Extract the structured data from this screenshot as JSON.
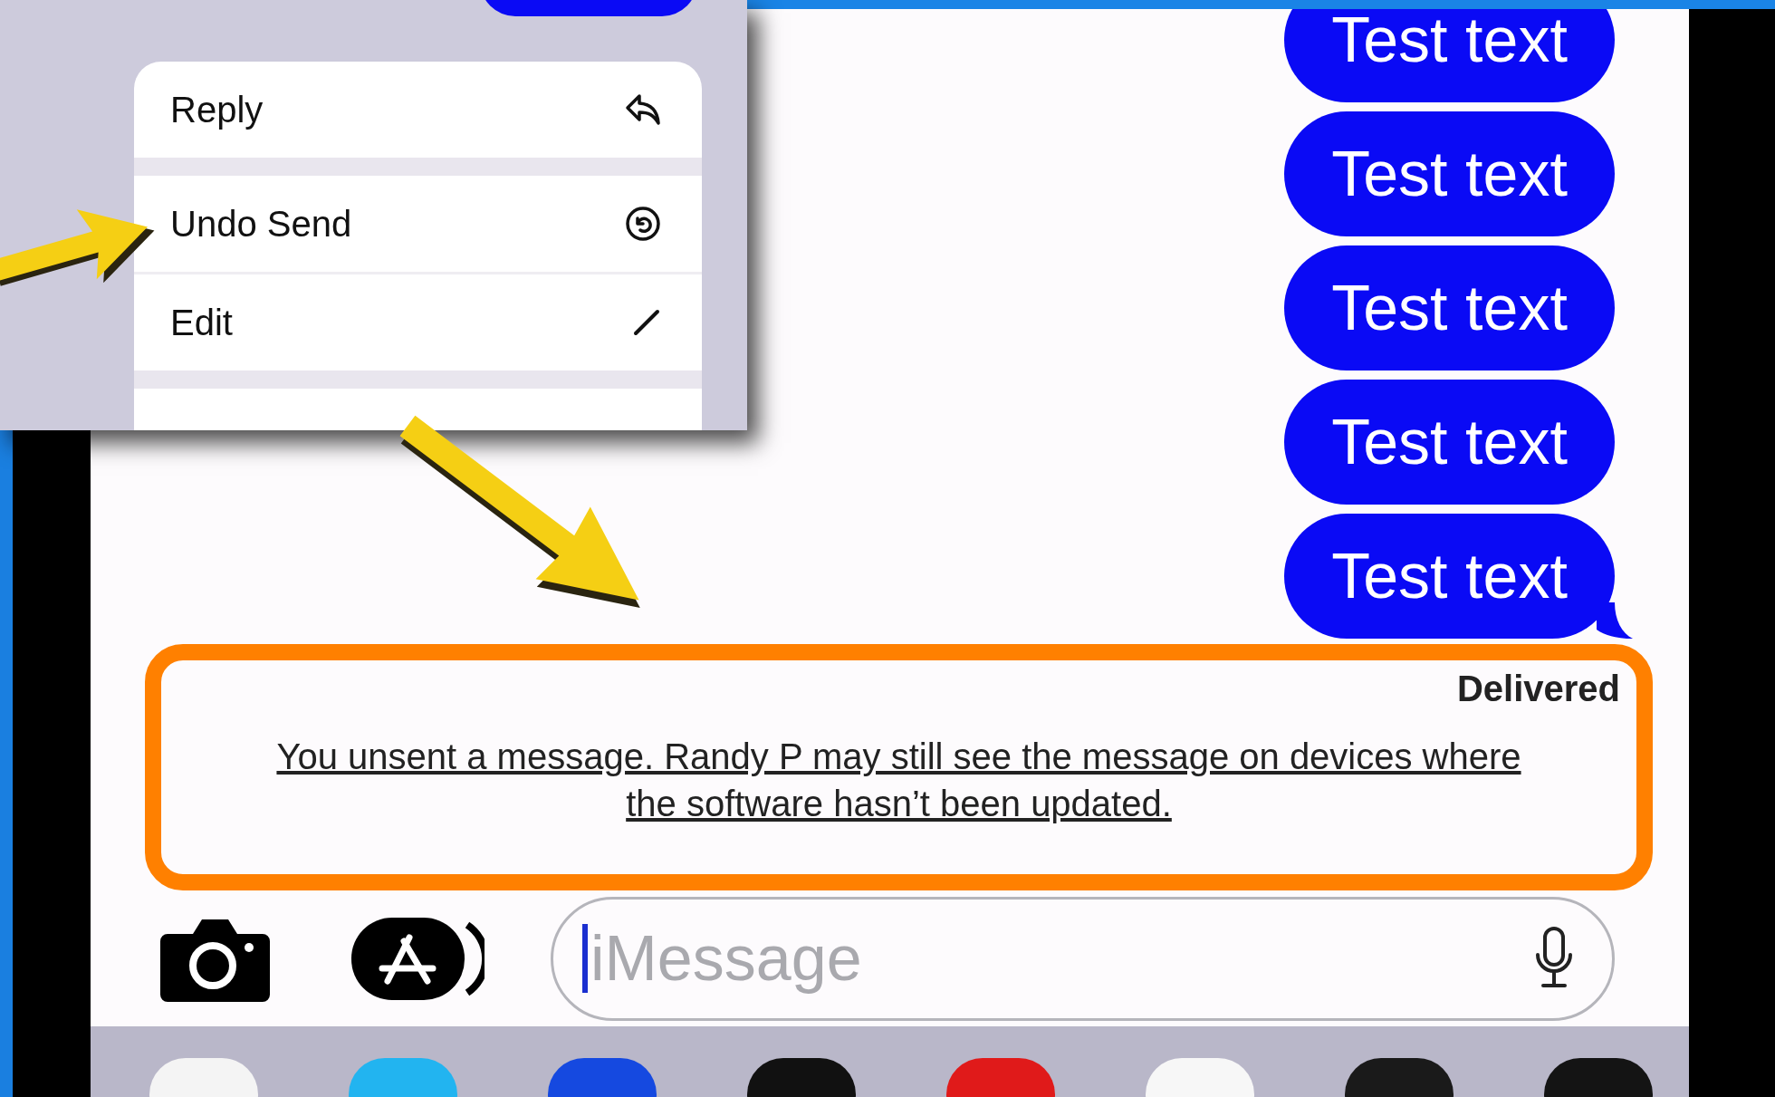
{
  "menu": {
    "items": [
      {
        "label": "Reply",
        "kind": "reply"
      },
      {
        "label": "Undo Send",
        "kind": "undo"
      },
      {
        "label": "Edit",
        "kind": "edit"
      }
    ]
  },
  "messages": [
    {
      "text": "Test text",
      "tail": false
    },
    {
      "text": "Test text",
      "tail": false
    },
    {
      "text": "Test text",
      "tail": false
    },
    {
      "text": "Test text",
      "tail": false
    },
    {
      "text": "Test text",
      "tail": true
    }
  ],
  "status": "Delivered",
  "notice": "You unsent a message. Randy P may still see the message on devices where the software hasn’t been updated.",
  "input": {
    "placeholder": "iMessage"
  }
}
